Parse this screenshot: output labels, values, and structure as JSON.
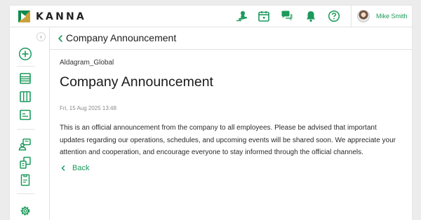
{
  "app": {
    "name": "KANNA"
  },
  "header": {
    "icons": [
      "stamp-icon",
      "calendar-icon",
      "chat-icon",
      "bell-icon",
      "help-icon"
    ],
    "user_name": "Mike Smith"
  },
  "sidebar": {
    "collapse_label": "›",
    "items": [
      "add-icon",
      "list-icon",
      "columns-icon",
      "card-icon",
      "users-icon",
      "building-icon",
      "document-icon",
      "settings-icon"
    ]
  },
  "page": {
    "title": "Company Announcement",
    "author": "Aldagram_Global",
    "announcement_title": "Company Announcement",
    "date": "Fri, 15 Aug 2025 13:48",
    "body": "This is an official announcement from the company to all employees. Please be advised that important updates regarding our operations, schedules, and upcoming events will be shared soon. We appreciate your attention and cooperation, and encourage everyone to stay informed through the official channels.",
    "back_label": "Back"
  },
  "colors": {
    "accent": "#1b9a5b",
    "logo_green": "#0f8a4f",
    "logo_gold": "#c9a23a"
  }
}
